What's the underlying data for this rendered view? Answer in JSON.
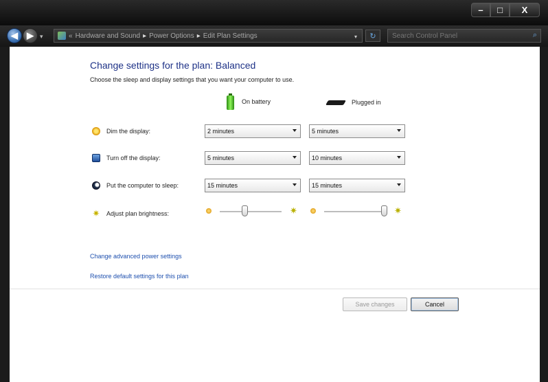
{
  "window": {
    "min_label": "–",
    "max_label": "□",
    "close_label": "X"
  },
  "navigation": {
    "back_glyph": "◀",
    "forward_glyph": "▶",
    "recent_glyph": "▾",
    "breadcrumb": {
      "prefix": "«",
      "items": [
        "Hardware and Sound",
        "Power Options",
        "Edit Plan Settings"
      ],
      "separator": "▸"
    },
    "dropdown_glyph": "▾",
    "refresh_glyph": "↻",
    "search_placeholder": "Search Control Panel",
    "search_glyph": "⌕"
  },
  "page": {
    "heading": "Change settings for the plan: Balanced",
    "subtitle": "Choose the sleep and display settings that you want your computer to use.",
    "columns": {
      "battery": "On battery",
      "plugged": "Plugged in"
    },
    "rows": {
      "dim": {
        "label": "Dim the display:",
        "icon": "dim-display-icon",
        "battery": "2 minutes",
        "plugged": "5 minutes"
      },
      "off": {
        "label": "Turn off the display:",
        "icon": "monitor-icon",
        "battery": "5 minutes",
        "plugged": "10 minutes"
      },
      "sleep": {
        "label": "Put the computer to sleep:",
        "icon": "sleep-moon-icon",
        "battery": "15 minutes",
        "plugged": "15 minutes"
      },
      "brightness": {
        "label": "Adjust plan brightness:",
        "icon": "brightness-sun-icon",
        "battery_level": 0.4,
        "plugged_level": 0.97,
        "bright_glyph": "✷"
      }
    },
    "links": {
      "advanced": "Change advanced power settings",
      "restore": "Restore default settings for this plan"
    },
    "buttons": {
      "save": "Save changes",
      "cancel": "Cancel"
    }
  },
  "colors": {
    "heading": "#1e3287",
    "link": "#1d4fae",
    "titlebar": "#111111"
  }
}
